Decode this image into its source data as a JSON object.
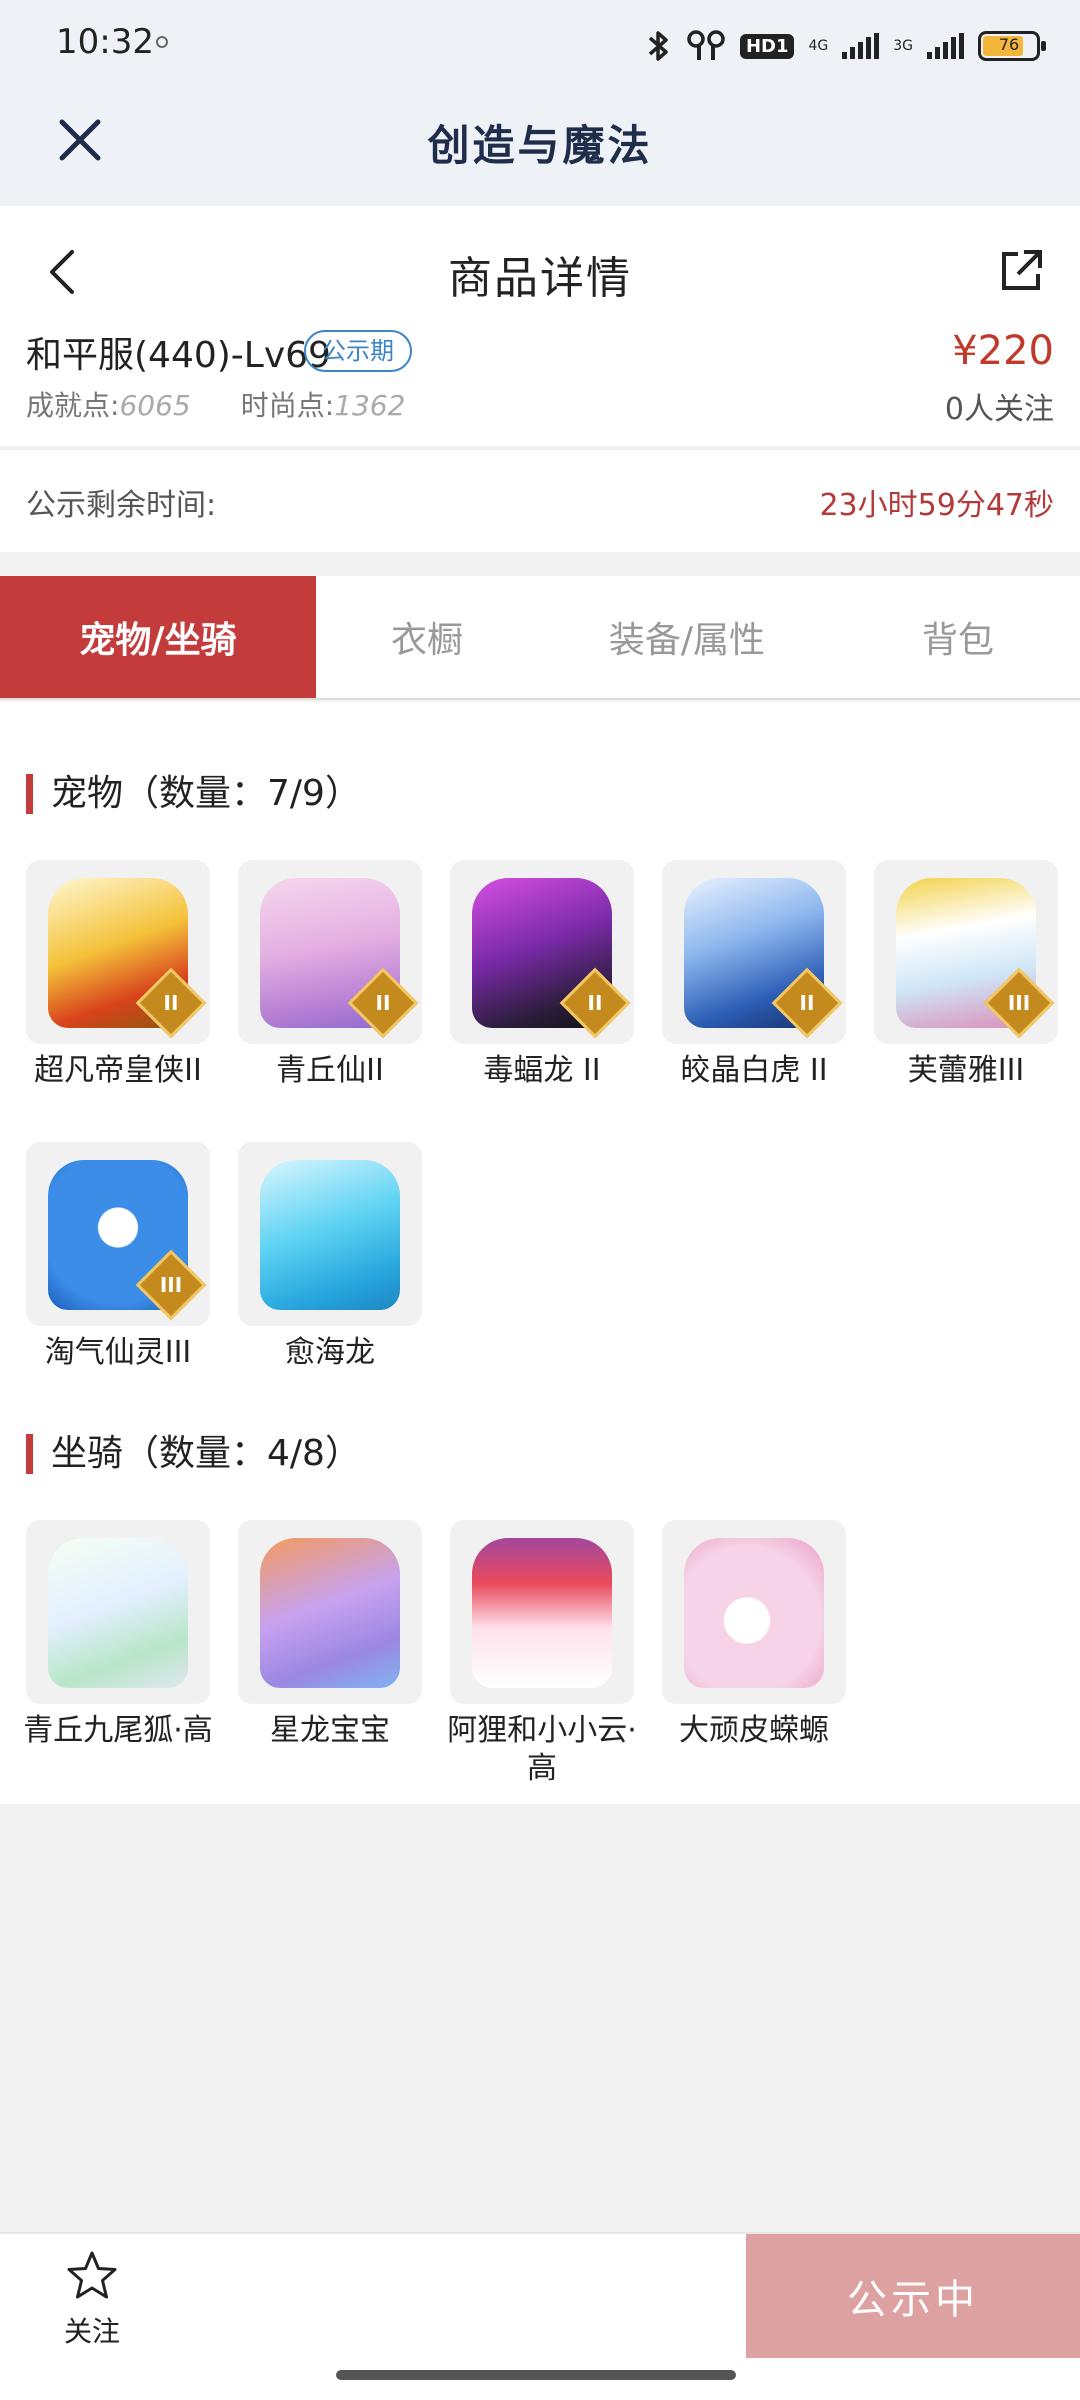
{
  "status_bar": {
    "time": "10:32",
    "network_4g": "4G",
    "network_3g": "3G",
    "hd_badge": "HD1",
    "battery": "76"
  },
  "app_bar": {
    "title": "创造与魔法"
  },
  "detail": {
    "page_title": "商品详情",
    "item_name": "和平服(440)-Lv69",
    "status_badge": "公示期",
    "price": "¥220",
    "achievement_label": "成就点:",
    "achievement_value": "6065",
    "fashion_label": "时尚点:",
    "fashion_value": "1362",
    "followers": "0人关注"
  },
  "remaining": {
    "label": "公示剩余时间:",
    "value": "23小时59分47秒"
  },
  "tabs": [
    {
      "label": "宠物/坐骑",
      "active": true
    },
    {
      "label": "衣橱",
      "active": false
    },
    {
      "label": "装备/属性",
      "active": false
    },
    {
      "label": "背包",
      "active": false
    }
  ],
  "pets": {
    "title": "宠物（数量：7/9）",
    "items": [
      {
        "name": "超凡帝皇侠II",
        "grade": "II"
      },
      {
        "name": "青丘仙II",
        "grade": "II"
      },
      {
        "name": "毒蝠龙 II",
        "grade": "II"
      },
      {
        "name": "皎晶白虎 II",
        "grade": "II"
      },
      {
        "name": "芙蕾雅III",
        "grade": "III"
      },
      {
        "name": "淘气仙灵III",
        "grade": "III"
      },
      {
        "name": "愈海龙",
        "grade": ""
      }
    ]
  },
  "mounts": {
    "title": "坐骑（数量：4/8）",
    "items": [
      {
        "name": "青丘九尾狐·高"
      },
      {
        "name": "星龙宝宝"
      },
      {
        "name": "阿狸和小小云·高"
      },
      {
        "name": "大顽皮蝾螈"
      }
    ]
  },
  "bottom_bar": {
    "follow_label": "关注",
    "action_label": "公示中"
  },
  "colors": {
    "accent": "#c33b3b",
    "price": "#c0392b",
    "badge": "#3b84c9",
    "action_disabled": "#dea1a1"
  }
}
